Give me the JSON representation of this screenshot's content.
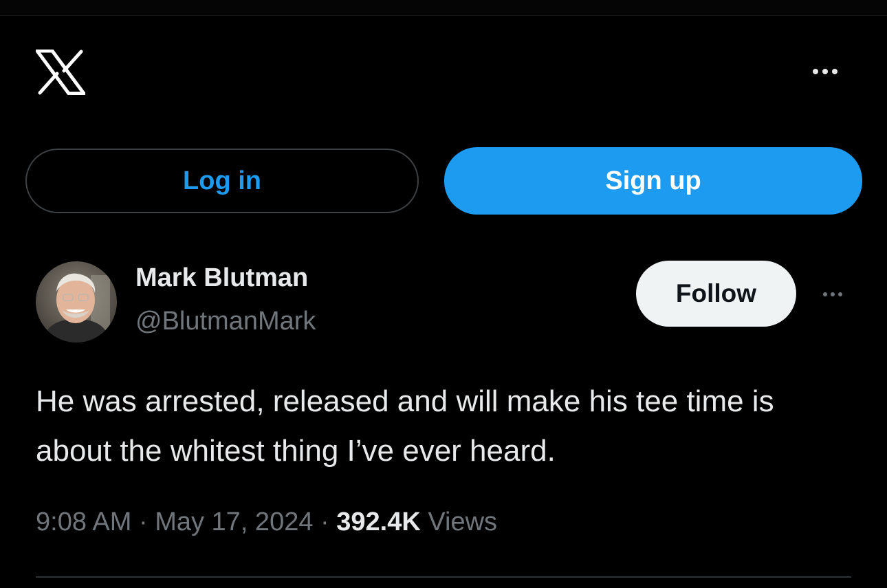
{
  "header": {
    "logo_icon": "x-logo-icon",
    "more_icon": "more-horizontal-icon"
  },
  "auth": {
    "login_label": "Log in",
    "signup_label": "Sign up"
  },
  "tweet": {
    "author_name": "Mark Blutman",
    "author_handle": "@BlutmanMark",
    "follow_label": "Follow",
    "text": "He was arrested, released and will make his tee time is about the whitest thing I’ve ever heard.",
    "time": "9:08 AM",
    "date": "May 17, 2024",
    "views_count": "392.4K",
    "views_label": "Views",
    "separator": "·"
  },
  "colors": {
    "background": "#000000",
    "accent": "#1d9bf0",
    "text_primary": "#e7e9ea",
    "text_secondary": "#71767b",
    "follow_bg": "#eff3f4"
  }
}
